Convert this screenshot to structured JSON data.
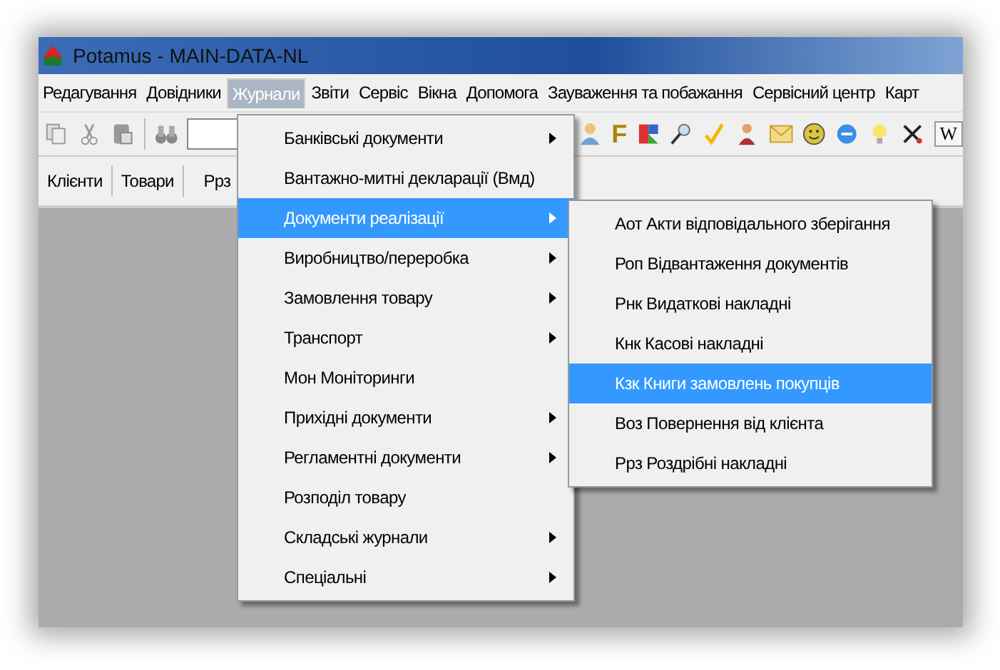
{
  "window": {
    "title": "Potamus - MAIN-DATA-NL"
  },
  "menu_bar": [
    {
      "label": "Редагування",
      "selected": false
    },
    {
      "label": "Довідники",
      "selected": false
    },
    {
      "label": "Журнали",
      "selected": true
    },
    {
      "label": "Звіти",
      "selected": false
    },
    {
      "label": "Сервіс",
      "selected": false
    },
    {
      "label": "Вікна",
      "selected": false
    },
    {
      "label": "Допомога",
      "selected": false
    },
    {
      "label": "Зауваження та побажання",
      "selected": false
    },
    {
      "label": "Сервісний центр",
      "selected": false
    },
    {
      "label": "Карт",
      "selected": false
    }
  ],
  "toolbar": {
    "letter_f": "F",
    "letter_w": "W"
  },
  "tabs": [
    {
      "label": "Клієнти"
    },
    {
      "label": "Товари"
    },
    {
      "label": "Ррз"
    }
  ],
  "dropdown": [
    {
      "label": "Банківські документи",
      "has_submenu": true,
      "selected": false
    },
    {
      "label": "Вантажно-митні декларації (Вмд)",
      "has_submenu": false,
      "selected": false
    },
    {
      "label": "Документи реалізації",
      "has_submenu": true,
      "selected": true
    },
    {
      "label": "Виробництво/переробка",
      "has_submenu": true,
      "selected": false
    },
    {
      "label": "Замовлення товару",
      "has_submenu": true,
      "selected": false
    },
    {
      "label": "Транспорт",
      "has_submenu": true,
      "selected": false
    },
    {
      "label": "Мон Моніторинги",
      "has_submenu": false,
      "selected": false
    },
    {
      "label": "Прихідні документи",
      "has_submenu": true,
      "selected": false
    },
    {
      "label": "Регламентні документи",
      "has_submenu": true,
      "selected": false
    },
    {
      "label": "Розподіл товару",
      "has_submenu": false,
      "selected": false
    },
    {
      "label": "Складські журнали",
      "has_submenu": true,
      "selected": false
    },
    {
      "label": "Спеціальні",
      "has_submenu": true,
      "selected": false
    }
  ],
  "submenu": [
    {
      "label": "Аот Акти відповідального зберігання",
      "selected": false
    },
    {
      "label": "Роп Відвантаження документів",
      "selected": false
    },
    {
      "label": "Рнк Видаткові накладні",
      "selected": false
    },
    {
      "label": "Кнк Касові накладні",
      "selected": false
    },
    {
      "label": "Кзк Книги замовлень покупців",
      "selected": true
    },
    {
      "label": "Воз Повернення від клієнта",
      "selected": false
    },
    {
      "label": "Ррз Роздрібні накладні",
      "selected": false
    }
  ]
}
